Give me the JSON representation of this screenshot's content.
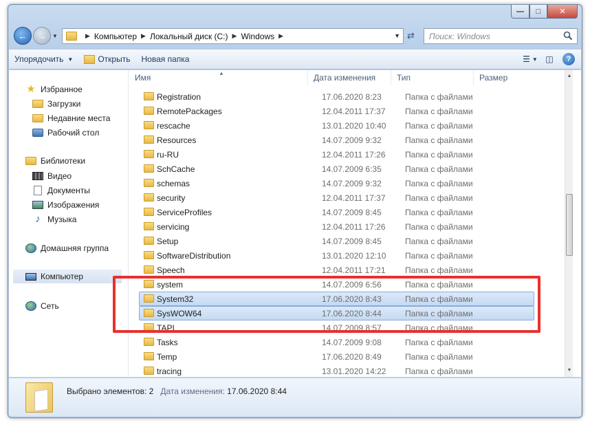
{
  "window": {
    "caption_buttons": {
      "minimize": "—",
      "maximize": "□",
      "close": "✕"
    }
  },
  "address": {
    "crumbs": [
      "Компьютер",
      "Локальный диск (C:)",
      "Windows"
    ],
    "search_placeholder": "Поиск: Windows"
  },
  "toolbar": {
    "organize": "Упорядочить",
    "open": "Открыть",
    "new_folder": "Новая папка"
  },
  "sidebar": {
    "favorites": {
      "label": "Избранное",
      "items": [
        "Загрузки",
        "Недавние места",
        "Рабочий стол"
      ]
    },
    "libraries": {
      "label": "Библиотеки",
      "items": [
        "Видео",
        "Документы",
        "Изображения",
        "Музыка"
      ]
    },
    "homegroup": "Домашняя группа",
    "computer": "Компьютер",
    "network": "Сеть"
  },
  "columns": {
    "name": "Имя",
    "date": "Дата изменения",
    "type": "Тип",
    "size": "Размер"
  },
  "files": [
    {
      "name": "Registration",
      "date": "17.06.2020 8:23",
      "type": "Папка с файлами"
    },
    {
      "name": "RemotePackages",
      "date": "12.04.2011 17:37",
      "type": "Папка с файлами"
    },
    {
      "name": "rescache",
      "date": "13.01.2020 10:40",
      "type": "Папка с файлами"
    },
    {
      "name": "Resources",
      "date": "14.07.2009 9:32",
      "type": "Папка с файлами"
    },
    {
      "name": "ru-RU",
      "date": "12.04.2011 17:26",
      "type": "Папка с файлами"
    },
    {
      "name": "SchCache",
      "date": "14.07.2009 6:35",
      "type": "Папка с файлами"
    },
    {
      "name": "schemas",
      "date": "14.07.2009 9:32",
      "type": "Папка с файлами"
    },
    {
      "name": "security",
      "date": "12.04.2011 17:37",
      "type": "Папка с файлами"
    },
    {
      "name": "ServiceProfiles",
      "date": "14.07.2009 8:45",
      "type": "Папка с файлами"
    },
    {
      "name": "servicing",
      "date": "12.04.2011 17:26",
      "type": "Папка с файлами"
    },
    {
      "name": "Setup",
      "date": "14.07.2009 8:45",
      "type": "Папка с файлами"
    },
    {
      "name": "SoftwareDistribution",
      "date": "13.01.2020 12:10",
      "type": "Папка с файлами"
    },
    {
      "name": "Speech",
      "date": "12.04.2011 17:21",
      "type": "Папка с файлами"
    },
    {
      "name": "system",
      "date": "14.07.2009 6:56",
      "type": "Папка с файлами"
    },
    {
      "name": "System32",
      "date": "17.06.2020 8:43",
      "type": "Папка с файлами",
      "selected": true
    },
    {
      "name": "SysWOW64",
      "date": "17.06.2020 8:44",
      "type": "Папка с файлами",
      "selected": true
    },
    {
      "name": "TAPI",
      "date": "14.07.2009 8:57",
      "type": "Папка с файлами"
    },
    {
      "name": "Tasks",
      "date": "14.07.2009 9:08",
      "type": "Папка с файлами"
    },
    {
      "name": "Temp",
      "date": "17.06.2020 8:49",
      "type": "Папка с файлами"
    },
    {
      "name": "tracing",
      "date": "13.01.2020 14:22",
      "type": "Папка с файлами"
    }
  ],
  "details": {
    "selected_count": "Выбрано элементов: 2",
    "date_label": "Дата изменения:",
    "date_value": "17.06.2020 8:44"
  },
  "colors": {
    "highlight": "#e8302e",
    "selection": "#c4daf3"
  }
}
